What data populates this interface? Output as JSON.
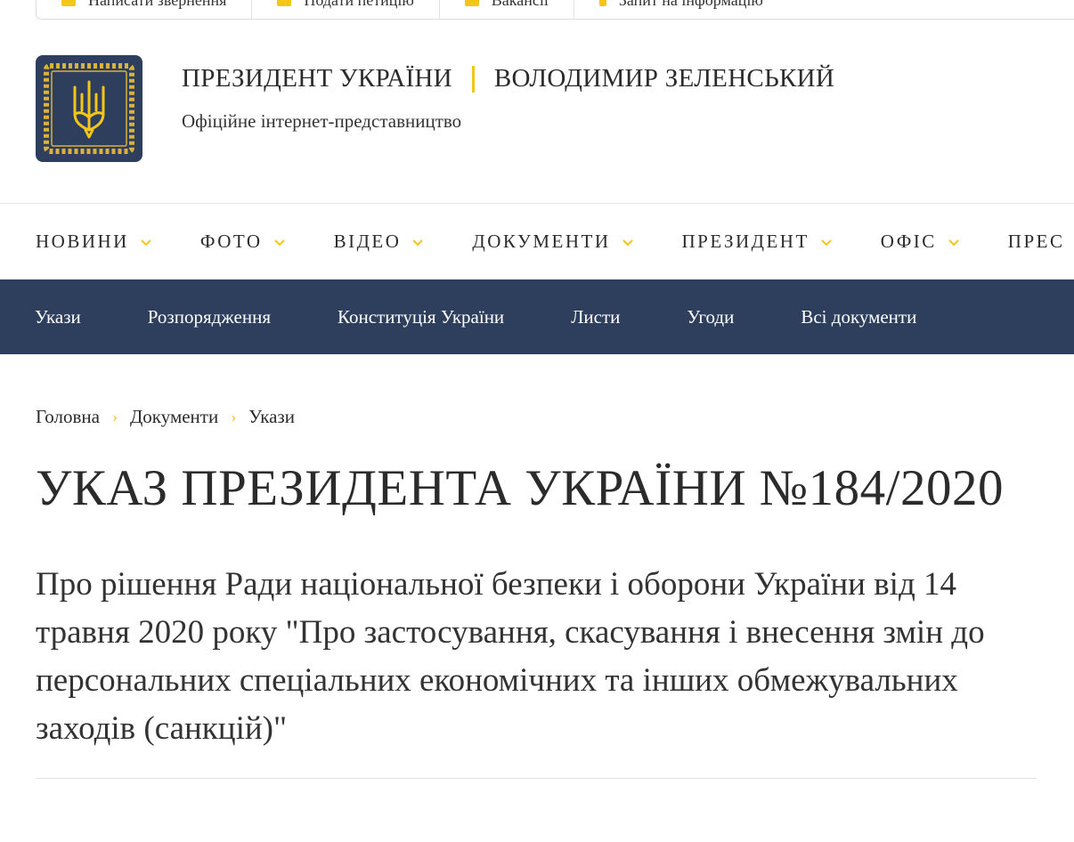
{
  "topbar": {
    "items": [
      {
        "label": "Написати звернення",
        "icon": "pen-icon"
      },
      {
        "label": "Подати петицію",
        "icon": "document-icon"
      },
      {
        "label": "Вакансії",
        "icon": "briefcase-icon"
      },
      {
        "label": "Запит на інформацію",
        "icon": "info-icon"
      }
    ]
  },
  "header": {
    "title_left": "ПРЕЗИДЕНТ УКРАЇНИ",
    "title_right": "ВОЛОДИМИР ЗЕЛЕНСЬКИЙ",
    "subtitle": "Офіційне інтернет-представництво",
    "logo_icon": "trident-coat-of-arms-icon"
  },
  "main_nav": {
    "items": [
      {
        "label": "НОВИНИ"
      },
      {
        "label": "ФОТО"
      },
      {
        "label": "ВІДЕО"
      },
      {
        "label": "ДОКУМЕНТИ"
      },
      {
        "label": "ПРЕЗИДЕНТ"
      },
      {
        "label": "ОФІС"
      },
      {
        "label": "ПРЕС"
      }
    ]
  },
  "sub_nav": {
    "items": [
      {
        "label": "Укази"
      },
      {
        "label": "Розпорядження"
      },
      {
        "label": "Конституція України"
      },
      {
        "label": "Листи"
      },
      {
        "label": "Угоди"
      },
      {
        "label": "Всі документи"
      }
    ]
  },
  "breadcrumb": {
    "items": [
      {
        "label": "Головна"
      },
      {
        "label": "Документи"
      },
      {
        "label": "Укази"
      }
    ],
    "separator": "›"
  },
  "document": {
    "title": "УКАЗ ПРЕЗИДЕНТА УКРАЇНИ №184/2020",
    "subtitle": "Про рішення Ради національної безпеки і оборони України від 14 травня 2020 року \"Про застосування, скасування і внесення змін до персональних спеціальних економічних та інших обмежувальних заходів (санкцій)\""
  },
  "colors": {
    "navy": "#2e3f5e",
    "accent_yellow": "#f5c518",
    "text": "#2b2b2b"
  }
}
